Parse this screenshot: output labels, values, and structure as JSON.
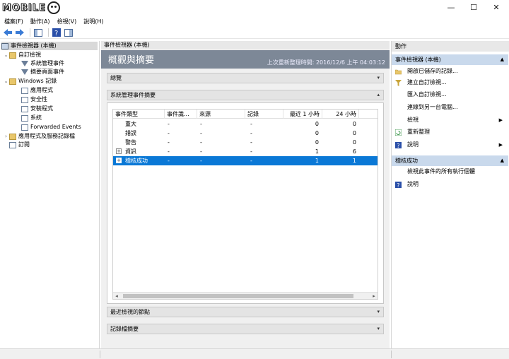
{
  "logo": {
    "text": "MOBILE"
  },
  "window_controls": {
    "minimize": "—",
    "maximize": "☐",
    "close": "✕"
  },
  "menu": [
    "檔案(F)",
    "動作(A)",
    "檢視(V)",
    "說明(H)"
  ],
  "tree": {
    "items": [
      {
        "label": "事件檢視器 (本機)",
        "icon": "event-viewer-icon",
        "selected": true
      },
      {
        "label": "自訂檢視",
        "icon": "folder-icon"
      },
      {
        "label": "系統管理事件",
        "icon": "filter-icon"
      },
      {
        "label": "摘要頁面事件",
        "icon": "filter-icon"
      },
      {
        "label": "Windows 記錄",
        "icon": "folder-icon"
      },
      {
        "label": "應用程式",
        "icon": "log-icon"
      },
      {
        "label": "安全性",
        "icon": "log-icon"
      },
      {
        "label": "安裝程式",
        "icon": "log-icon"
      },
      {
        "label": "系統",
        "icon": "log-icon"
      },
      {
        "label": "Forwarded Events",
        "icon": "log-icon"
      },
      {
        "label": "應用程式及服務記錄檔",
        "icon": "folder-icon"
      },
      {
        "label": "訂閱",
        "icon": "subscription-icon"
      }
    ]
  },
  "center": {
    "header": "事件檢視器 (本機)",
    "banner_title": "概觀與摘要",
    "last_refresh": "上次重新整理時間: 2016/12/6 上午 04:03:12",
    "sections": {
      "overview": "總覽",
      "summary": "系統管理事件摘要",
      "recent_nodes": "最近檢視的節點",
      "log_summary": "記錄檔摘要"
    },
    "columns": [
      "事件類型",
      "事件識...",
      "來源",
      "記錄",
      "最近 1 小時",
      "24 小時"
    ],
    "rows": [
      {
        "type": "重大",
        "id": "-",
        "source": "-",
        "log": "-",
        "last_hour": "0",
        "last_24h": "0",
        "expandable": false
      },
      {
        "type": "錯誤",
        "id": "-",
        "source": "-",
        "log": "-",
        "last_hour": "0",
        "last_24h": "0",
        "expandable": false
      },
      {
        "type": "警告",
        "id": "-",
        "source": "-",
        "log": "-",
        "last_hour": "0",
        "last_24h": "0",
        "expandable": false
      },
      {
        "type": "資訊",
        "id": "-",
        "source": "-",
        "log": "-",
        "last_hour": "1",
        "last_24h": "6",
        "expandable": true
      },
      {
        "type": "稽核成功",
        "id": "-",
        "source": "-",
        "log": "-",
        "last_hour": "1",
        "last_24h": "1",
        "expandable": true,
        "selected": true
      }
    ]
  },
  "actions": {
    "header": "動作",
    "group1": {
      "title": "事件檢視器 (本機)",
      "items": [
        {
          "label": "開啟已儲存的記錄...",
          "icon": "open-folder-icon"
        },
        {
          "label": "建立自訂檢視...",
          "icon": "filter-icon"
        },
        {
          "label": "匯入自訂檢視...",
          "icon": ""
        },
        {
          "label": "連線到另一台電腦...",
          "icon": ""
        },
        {
          "label": "檢視",
          "icon": "",
          "submenu": true
        },
        {
          "label": "重新整理",
          "icon": "refresh-icon"
        },
        {
          "label": "說明",
          "icon": "help-icon",
          "submenu": true
        }
      ]
    },
    "group2": {
      "title": "稽核成功",
      "items": [
        {
          "label": "檢視此事件的所有執行個體",
          "icon": ""
        },
        {
          "label": "說明",
          "icon": "help-icon"
        }
      ]
    }
  },
  "colors": {
    "selection": "#0a78d6",
    "banner": "#7d8897",
    "action_group": "#c9d9ec"
  }
}
